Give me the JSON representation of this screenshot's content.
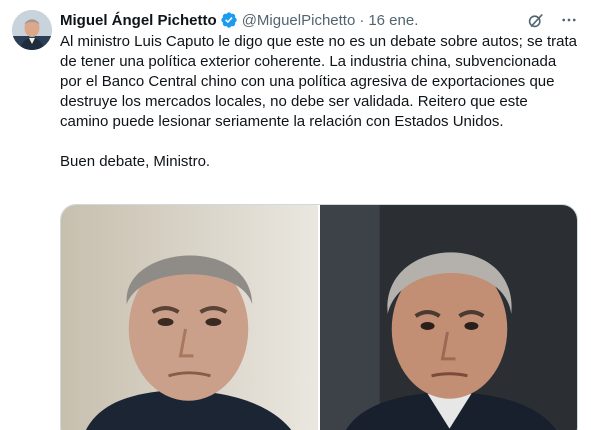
{
  "tweet": {
    "author_name": "Miguel Ángel Pichetto",
    "handle": "@MiguelPichetto",
    "separator": "·",
    "date": "16 ene.",
    "paragraph_1": "Al ministro Luis Caputo le digo que este no es un debate sobre autos; se trata de tener una política exterior coherente. La industria china, subvencionada por el Banco Central chino con una política agresiva de exportaciones que destruye los mercados locales, no debe ser validada. Reitero que este camino puede lesionar seriamente la relación con Estados Unidos.",
    "paragraph_2": "Buen debate, Ministro.",
    "more_label": "···"
  },
  "icons": {
    "verified": "verified-badge-icon",
    "grok": "grok-icon",
    "more": "more-icon"
  },
  "colors": {
    "text": "#0f1419",
    "secondary": "#536471",
    "verified": "#1d9bf0",
    "border": "#cfd9de"
  }
}
